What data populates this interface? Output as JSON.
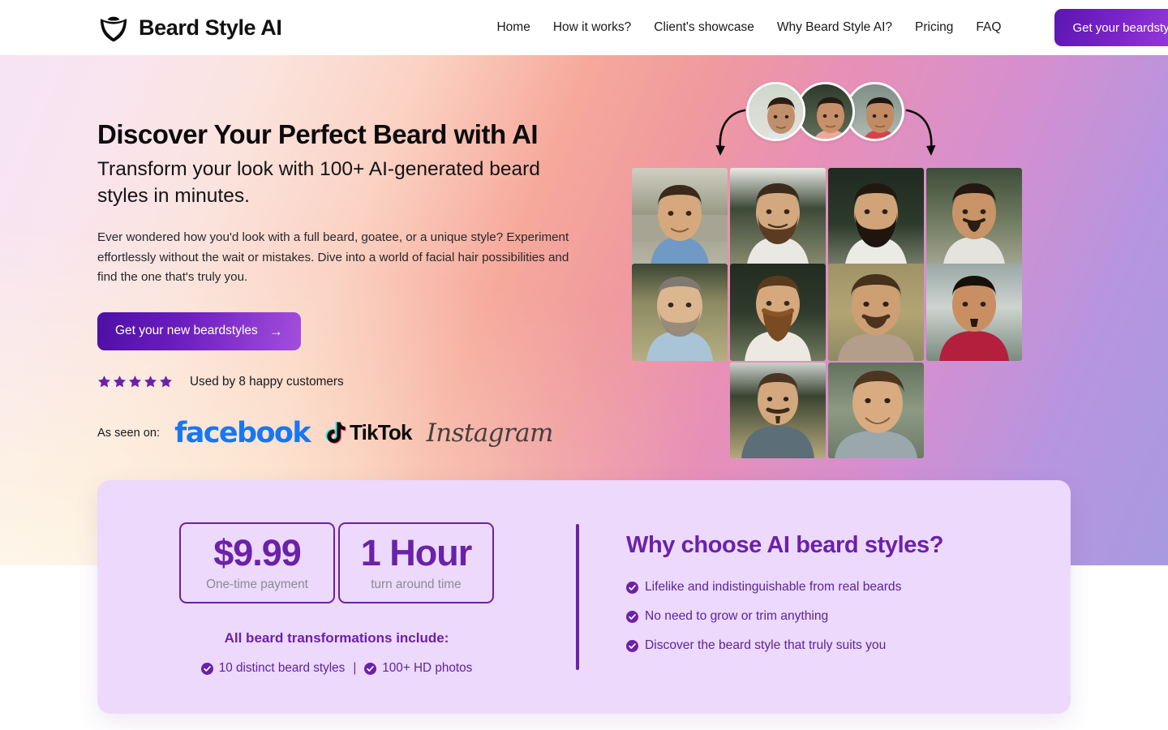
{
  "brand": {
    "name": "Beard Style AI",
    "logo_icon": "beard-logo-icon"
  },
  "nav": {
    "links": [
      {
        "label": "Home"
      },
      {
        "label": "How it works?"
      },
      {
        "label": "Client's showcase"
      },
      {
        "label": "Why Beard Style AI?"
      },
      {
        "label": "Pricing"
      },
      {
        "label": "FAQ"
      }
    ],
    "cta_label": "Get your beardstyles"
  },
  "hero": {
    "heading": "Discover Your Perfect Beard with AI",
    "subheading": "Transform your look with 100+ AI-generated beard styles in minutes.",
    "body": "Ever wondered how you'd look with a full beard, goatee, or a unique style? Experiment effortlessly without the wait or mistakes. Dive into a world of facial hair possibilities and find the one that's truly you.",
    "cta_label": "Get your new beardstyles",
    "cta_arrow": "→",
    "rating_stars": 5,
    "rating_text": "Used by 8 happy customers",
    "as_seen_label": "As seen on:",
    "as_seen_logos": [
      {
        "name": "facebook-logo",
        "label": "facebook"
      },
      {
        "name": "tiktok-logo",
        "label": "TikTok"
      },
      {
        "name": "instagram-logo",
        "label": "Instagram"
      }
    ]
  },
  "panel": {
    "stats": [
      {
        "value": "$9.99",
        "label": "One-time payment"
      },
      {
        "value": "1 Hour",
        "label": "turn around time"
      }
    ],
    "include_title": "All beard transformations include:",
    "include_items": [
      {
        "label": "10 distinct beard styles"
      },
      {
        "label": "100+ HD photos"
      }
    ],
    "include_separator": "|",
    "why_title": "Why choose AI beard styles?",
    "benefits": [
      {
        "label": "Lifelike and indistinguishable from real beards"
      },
      {
        "label": "No need to grow or trim anything"
      },
      {
        "label": "Discover the beard style that truly suits you"
      }
    ]
  },
  "colors": {
    "accent_purple": "#6b21a8",
    "cta_gradient_start": "#4d0fa4",
    "cta_gradient_end": "#a44fdd",
    "panel_bg": "#ecd9fb",
    "facebook_blue": "#1877F2",
    "star_purple": "#6b21a8"
  }
}
